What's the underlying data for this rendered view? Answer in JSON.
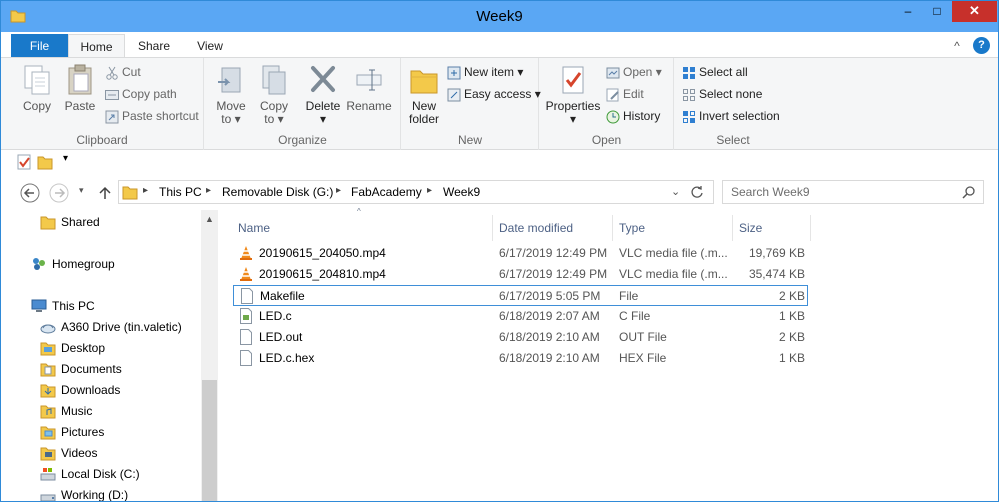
{
  "window": {
    "title": "Week9",
    "minimize_label": "–",
    "maximize_label": "□",
    "close_label": "✕"
  },
  "tabs": [
    {
      "label": "File"
    },
    {
      "label": "Home"
    },
    {
      "label": "Share"
    },
    {
      "label": "View"
    }
  ],
  "ribbon_toggle": {
    "chevron_label": "^",
    "help_label": "?"
  },
  "ribbon": {
    "clipboard": {
      "group_label": "Clipboard",
      "copy_label": "Copy",
      "paste_label": "Paste",
      "cut_label": "Cut",
      "copy_path_label": "Copy path",
      "paste_shortcut_label": "Paste shortcut"
    },
    "organize": {
      "group_label": "Organize",
      "move_to_label": "Move",
      "move_to_label2": "to",
      "copy_to_label": "Copy",
      "copy_to_label2": "to",
      "delete_label": "Delete",
      "rename_label": "Rename"
    },
    "new": {
      "group_label": "New",
      "new_folder_label": "New",
      "new_folder_label2": "folder",
      "new_item_label": "New item",
      "easy_access_label": "Easy access"
    },
    "open": {
      "group_label": "Open",
      "properties_label": "Properties",
      "open_label": "Open",
      "edit_label": "Edit",
      "history_label": "History"
    },
    "select": {
      "group_label": "Select",
      "select_all_label": "Select all",
      "select_none_label": "Select none",
      "invert_selection_label": "Invert selection"
    }
  },
  "address": {
    "crumbs": [
      "This PC",
      "Removable Disk (G:)",
      "FabAcademy",
      "Week9"
    ],
    "search_placeholder": "Search Week9"
  },
  "nav": {
    "items": [
      {
        "label": "Shared",
        "icon": "folder-icon"
      },
      {
        "label": "Homegroup",
        "icon": "homegroup-icon"
      },
      {
        "label": "This PC",
        "icon": "computer-icon"
      },
      {
        "label": "A360 Drive (tin.valetic)",
        "icon": "cloud-drive-icon"
      },
      {
        "label": "Desktop",
        "icon": "folder-icon"
      },
      {
        "label": "Documents",
        "icon": "folder-icon"
      },
      {
        "label": "Downloads",
        "icon": "folder-icon"
      },
      {
        "label": "Music",
        "icon": "folder-icon"
      },
      {
        "label": "Pictures",
        "icon": "folder-icon"
      },
      {
        "label": "Videos",
        "icon": "folder-icon"
      },
      {
        "label": "Local Disk (C:)",
        "icon": "disk-icon"
      },
      {
        "label": "Working (D:)",
        "icon": "disk-icon"
      }
    ]
  },
  "columns": {
    "name": "Name",
    "date_modified": "Date modified",
    "type": "Type",
    "size": "Size"
  },
  "files": [
    {
      "name": "20190615_204050.mp4",
      "date": "6/17/2019 12:49 PM",
      "type": "VLC media file (.m...",
      "size": "19,769 KB",
      "icon": "vlc-icon"
    },
    {
      "name": "20190615_204810.mp4",
      "date": "6/17/2019 12:49 PM",
      "type": "VLC media file (.m...",
      "size": "35,474 KB",
      "icon": "vlc-icon"
    },
    {
      "name": "Makefile",
      "date": "6/17/2019 5:05 PM",
      "type": "File",
      "size": "2 KB",
      "icon": "file-icon"
    },
    {
      "name": "LED.c",
      "date": "6/18/2019 2:07 AM",
      "type": "C File",
      "size": "1 KB",
      "icon": "c-file-icon"
    },
    {
      "name": "LED.out",
      "date": "6/18/2019 2:10 AM",
      "type": "OUT File",
      "size": "2 KB",
      "icon": "file-icon"
    },
    {
      "name": "LED.c.hex",
      "date": "6/18/2019 2:10 AM",
      "type": "HEX File",
      "size": "1 KB",
      "icon": "file-icon"
    }
  ],
  "colors": {
    "titlebar": "#5aa7f4",
    "file_tab": "#1979ca",
    "close_button": "#c7302b",
    "selection_border": "#3f8fd8"
  }
}
